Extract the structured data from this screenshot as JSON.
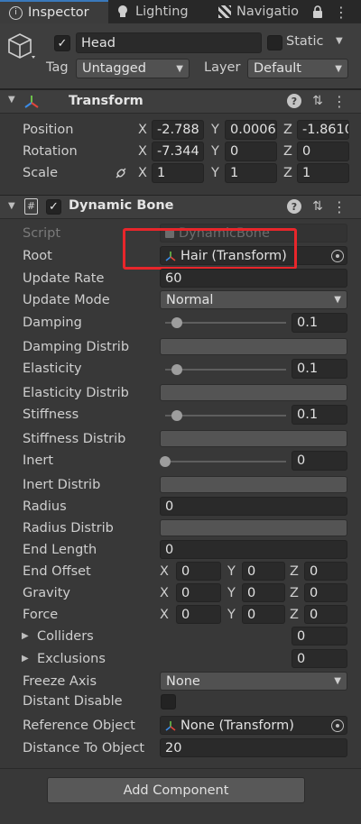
{
  "tabs": [
    {
      "label": "Inspector",
      "icon": "info-icon"
    },
    {
      "label": "Lighting",
      "icon": "bulb-icon"
    },
    {
      "label": "Navigatio",
      "icon": "navigation-icon"
    }
  ],
  "window_controls": {
    "lock": "lock-icon",
    "menu": "kebab-menu-icon"
  },
  "object": {
    "name": "Head",
    "active": true,
    "static_label": "Static",
    "static": false,
    "tag_label": "Tag",
    "tag_value": "Untagged",
    "layer_label": "Layer",
    "layer_value": "Default"
  },
  "transform": {
    "title": "Transform",
    "position_label": "Position",
    "position": {
      "x": "-2.788",
      "y": "0.0006",
      "z": "-1.8610"
    },
    "rotation_label": "Rotation",
    "rotation": {
      "x": "-7.344",
      "y": "0",
      "z": "0"
    },
    "scale_label": "Scale",
    "scale": {
      "x": "1",
      "y": "1",
      "z": "1"
    }
  },
  "axes": {
    "x": "X",
    "y": "Y",
    "z": "Z"
  },
  "dynamic_bone": {
    "title": "Dynamic Bone",
    "enabled": true,
    "script_label": "Script",
    "script_value": "DynamicBone",
    "root_label": "Root",
    "root_value": "Hair (Transform)",
    "update_rate_label": "Update Rate",
    "update_rate": "60",
    "update_mode_label": "Update Mode",
    "update_mode": "Normal",
    "damping_label": "Damping",
    "damping": "0.1",
    "damping_distrib_label": "Damping Distrib",
    "elasticity_label": "Elasticity",
    "elasticity": "0.1",
    "elasticity_distrib_label": "Elasticity Distrib",
    "stiffness_label": "Stiffness",
    "stiffness": "0.1",
    "stiffness_distrib_label": "Stiffness Distrib",
    "inert_label": "Inert",
    "inert": "0",
    "inert_distrib_label": "Inert Distrib",
    "radius_label": "Radius",
    "radius": "0",
    "radius_distrib_label": "Radius Distrib",
    "end_length_label": "End Length",
    "end_length": "0",
    "end_offset_label": "End Offset",
    "end_offset": {
      "x": "0",
      "y": "0",
      "z": "0"
    },
    "gravity_label": "Gravity",
    "gravity": {
      "x": "0",
      "y": "0",
      "z": "0"
    },
    "force_label": "Force",
    "force": {
      "x": "0",
      "y": "0",
      "z": "0"
    },
    "colliders_label": "Colliders",
    "colliders_count": "0",
    "exclusions_label": "Exclusions",
    "exclusions_count": "0",
    "freeze_axis_label": "Freeze Axis",
    "freeze_axis": "None",
    "distant_disable_label": "Distant Disable",
    "distant_disable": false,
    "reference_object_label": "Reference Object",
    "reference_object": "None (Transform)",
    "distance_label": "Distance To Object",
    "distance": "20"
  },
  "add_component_label": "Add Component",
  "colors": {
    "highlight_box": "#e8262b",
    "tab_accent": "#3a79bb",
    "background": "#383838"
  }
}
